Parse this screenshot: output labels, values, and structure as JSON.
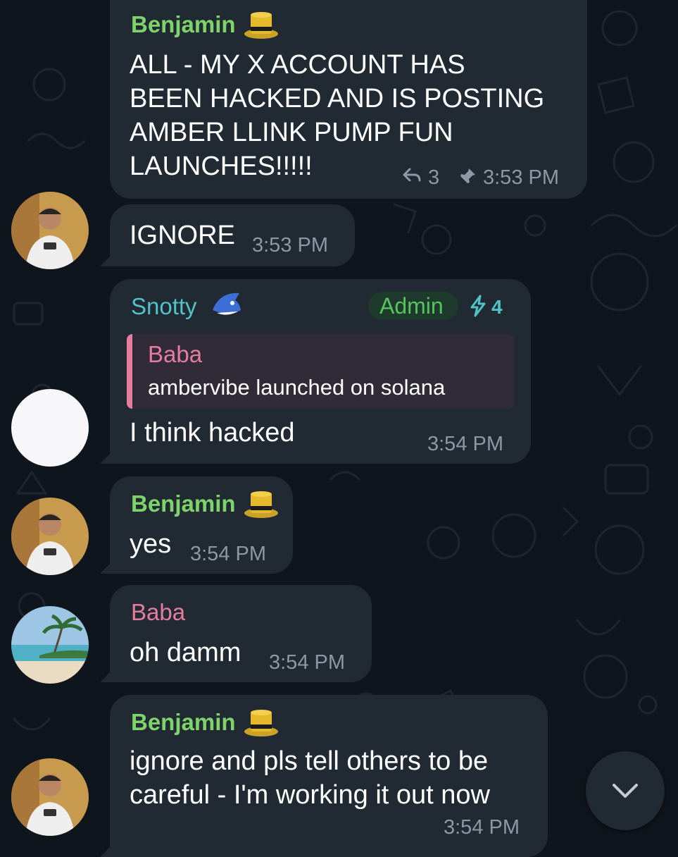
{
  "colors": {
    "background": "#0f151d",
    "bubble": "#212a33",
    "benjamin_name": "#7ed36a",
    "snotty_name": "#4fc3c7",
    "baba_name": "#e57d9f",
    "admin_badge_bg": "#1d3a2c",
    "admin_text": "#56c45c",
    "boost": "#4fc3c7",
    "timestamp": "#8d98a4"
  },
  "messages": [
    {
      "sender": "Benjamin",
      "lines": [
        "ALL - MY X ACCOUNT HAS",
        "BEEN HACKED AND IS POSTING",
        "AMBER LLINK PUMP FUN",
        "LAUNCHES!!!!!"
      ],
      "replies_count": "3",
      "time": "3:53 PM",
      "pinned_icon": "pin-icon",
      "reply_icon": "reply-arrow-icon"
    },
    {
      "text": "IGNORE",
      "time": "3:53 PM"
    },
    {
      "sender": "Snotty",
      "badge": "Admin",
      "boost_count": "4",
      "quote": {
        "sender": "Baba",
        "text": "ambervibe launched on solana"
      },
      "text": "I think hacked",
      "time": "3:54 PM"
    },
    {
      "sender": "Benjamin",
      "text": "yes",
      "time": "3:54 PM"
    },
    {
      "sender": "Baba",
      "text": "oh damm",
      "time": "3:54 PM"
    },
    {
      "sender": "Benjamin",
      "lines": [
        "ignore and pls tell others to be",
        "careful - I'm working it out now"
      ],
      "time": "3:54 PM"
    }
  ],
  "scroll_button_icon": "chevron-down-icon"
}
